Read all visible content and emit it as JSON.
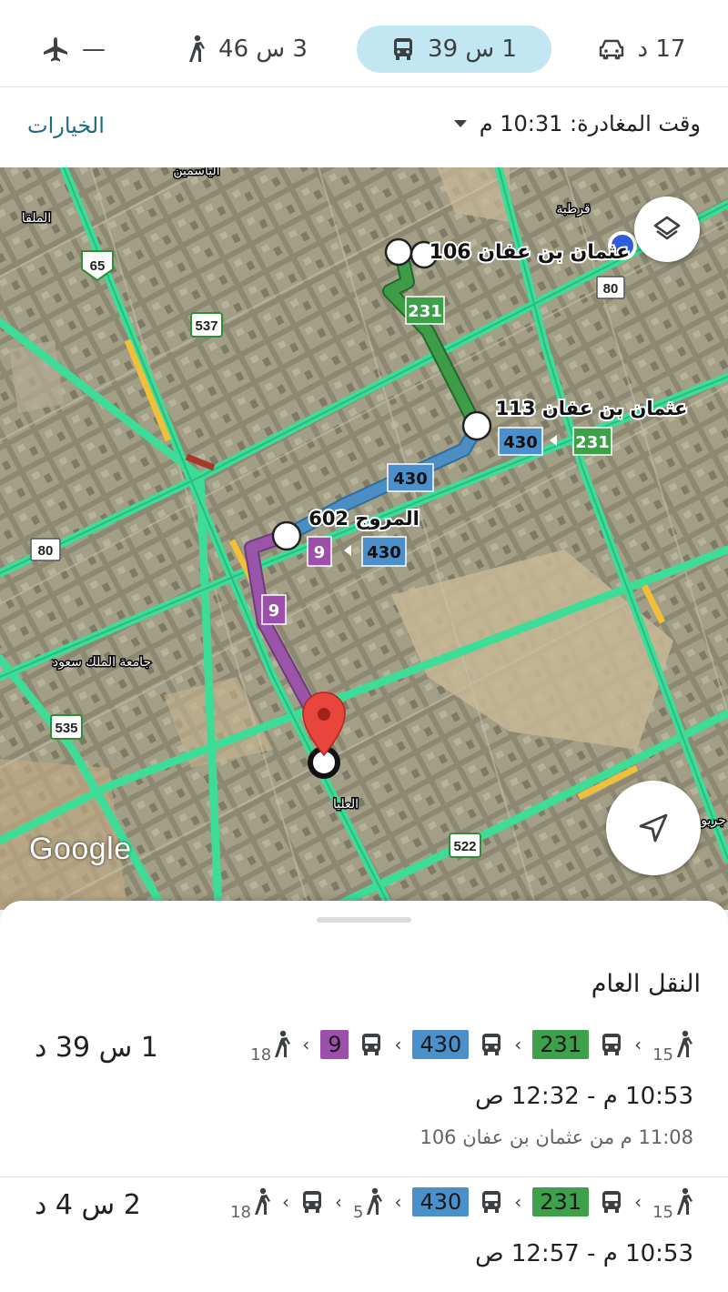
{
  "modes": {
    "drive": {
      "label": "17 د"
    },
    "transit": {
      "label": "1 س 39"
    },
    "walk": {
      "label": "3 س 46"
    },
    "flight": {
      "label": "—"
    }
  },
  "departure": {
    "options_label": "الخيارات",
    "depart_label": "وقت المغادرة: 10:31 م"
  },
  "map": {
    "labels": {
      "stop_top": "عثمان بن عفان 106",
      "stop_mid": "عثمان بن عفان 113",
      "stop_low": "المروج 602",
      "area_olaya": "العليا",
      "area_king_saud": "جامعة الملك سعود",
      "area_qurtuba": "قرطبة",
      "area_malqa": "الملقا",
      "area_yasmin": "الياسمين",
      "area_east": "جريو"
    },
    "route_badges": {
      "green": "231",
      "blue": "430",
      "purple": "9"
    },
    "road_shields": [
      "65",
      "537",
      "80",
      "80",
      "535",
      "522"
    ],
    "watermark": "Google"
  },
  "sheet": {
    "title": "النقل العام",
    "routes": [
      {
        "duration": "1 س 39 د",
        "walk_start": "15",
        "bus1": "231",
        "bus2": "430",
        "bus3": "9",
        "walk_end": "18",
        "times": "10:53 م - 12:32 ص",
        "from": "11:08 م من عثمان بن عفان 106"
      },
      {
        "duration": "2 س 4 د",
        "walk_start": "15",
        "bus1": "231",
        "bus2": "430",
        "walk_mid": "5",
        "walk_end": "18",
        "times": "10:53 م - 12:57 ص"
      }
    ]
  },
  "colors": {
    "route_green": "#3e9b48",
    "route_blue": "#4a8ec4",
    "route_purple": "#9a55a8",
    "badge_green": "#3ea04a",
    "badge_blue": "#4b8fcb",
    "badge_purple": "#9c4fab",
    "highway": "#3ddc97",
    "pin": "#e8453c",
    "accent": "#1f6b80",
    "active_mode_bg": "#c2e7f2"
  },
  "icons": [
    "car-icon",
    "bus-icon",
    "walk-icon",
    "plane-icon",
    "layers-icon",
    "navigation-icon",
    "map-pin-icon",
    "caret-down-icon"
  ]
}
